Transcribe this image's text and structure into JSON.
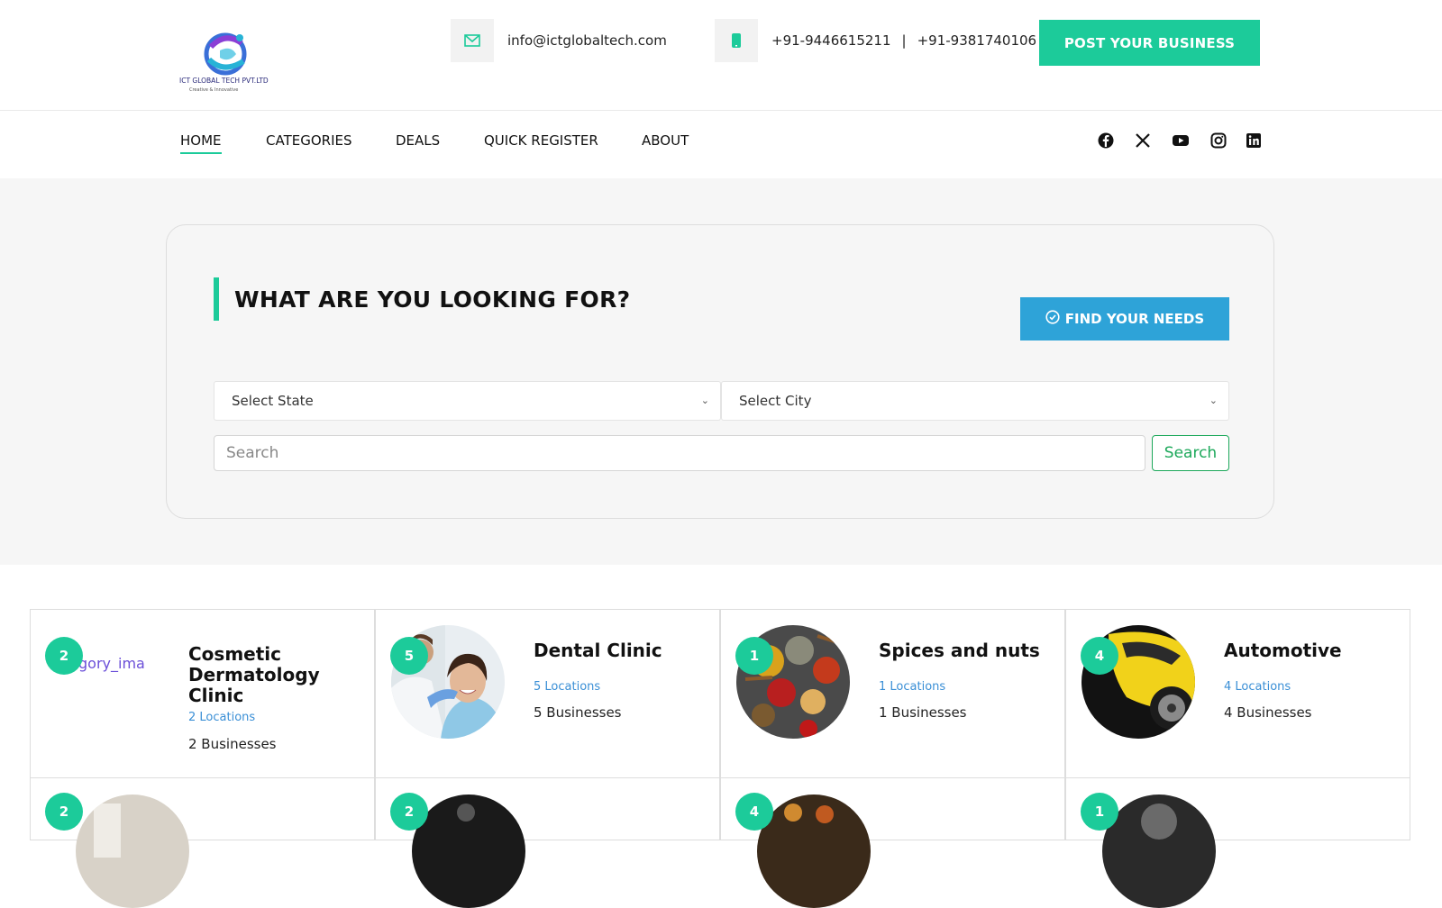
{
  "header": {
    "logo_alt": "ICT GLOBAL TECH PVT.LTD",
    "logo_tagline": "Creative & Innovative",
    "email": "info@ictglobaltech.com",
    "phone1": "+91-9446615211",
    "phone_sep": "|",
    "phone2": "+91-9381740106",
    "post_button": "POST YOUR BUSINESS"
  },
  "nav": {
    "items": [
      "HOME",
      "CATEGORIES",
      "DEALS",
      "QUICK REGISTER",
      "ABOUT"
    ],
    "social": [
      "facebook-icon",
      "x-icon",
      "youtube-icon",
      "instagram-icon",
      "linkedin-icon"
    ]
  },
  "search": {
    "heading": "WHAT ARE YOU LOOKING FOR?",
    "find_button": "FIND YOUR NEEDS",
    "state_placeholder": "Select State",
    "city_placeholder": "Select City",
    "input_placeholder": "Search",
    "search_button": "Search"
  },
  "categories": [
    {
      "count": "2",
      "title": "Cosmetic Dermatology Clinic",
      "locations": "2 Locations",
      "businesses": "2 Businesses",
      "broken_image_text": "gory_ima"
    },
    {
      "count": "5",
      "title": "Dental Clinic",
      "locations": "5 Locations",
      "businesses": "5 Businesses"
    },
    {
      "count": "1",
      "title": "Spices and nuts",
      "locations": "1 Locations",
      "businesses": "1 Businesses"
    },
    {
      "count": "4",
      "title": "Automotive",
      "locations": "4 Locations",
      "businesses": "4 Businesses"
    },
    {
      "count": "2"
    },
    {
      "count": "2"
    },
    {
      "count": "4"
    },
    {
      "count": "1"
    }
  ],
  "colors": {
    "accent": "#1ccb9a",
    "find_button": "#2ea3d8",
    "link": "#3a8fd6"
  }
}
